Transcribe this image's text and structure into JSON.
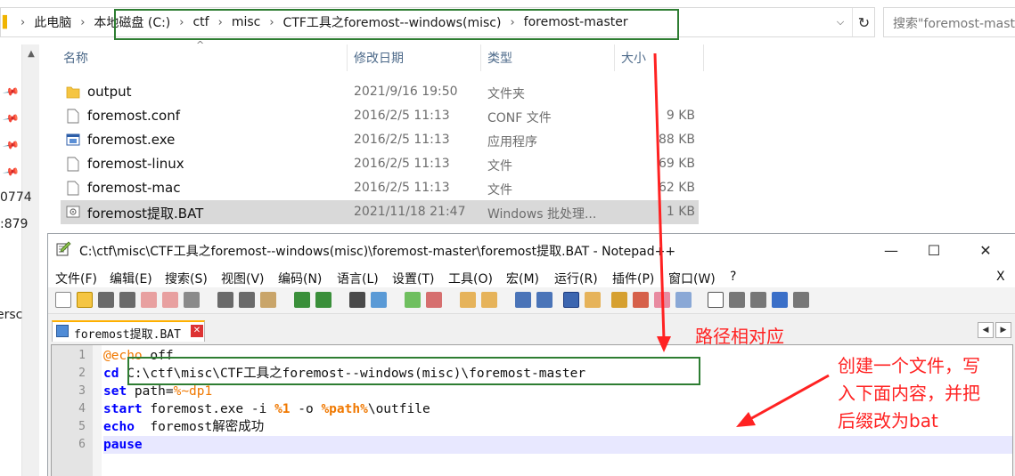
{
  "explorer": {
    "breadcrumbs": [
      "此电脑",
      "本地磁盘 (C:)",
      "ctf",
      "misc",
      "CTF工具之foremost--windows(misc)",
      "foremost-master"
    ],
    "breadcrumb_sep": "›",
    "dropdown_glyph": "⌵",
    "refresh_glyph": "↻",
    "search_placeholder": "搜索\"foremost-master\"",
    "scroll_up_glyph": "▲",
    "sort_glyph": "^",
    "pin_glyph": "📌",
    "left_cut_text": [
      "0774",
      ":879",
      "ersc"
    ],
    "columns": {
      "name": "名称",
      "date": "修改日期",
      "type": "类型",
      "size": "大小"
    },
    "files": [
      {
        "name": "output",
        "date": "2021/9/16 19:50",
        "type": "文件夹",
        "size": "",
        "icon": "folder-icon"
      },
      {
        "name": "foremost.conf",
        "date": "2016/2/5 11:13",
        "type": "CONF 文件",
        "size": "9 KB",
        "icon": "file-icon"
      },
      {
        "name": "foremost.exe",
        "date": "2016/2/5 11:13",
        "type": "应用程序",
        "size": "88 KB",
        "icon": "exe-icon"
      },
      {
        "name": "foremost-linux",
        "date": "2016/2/5 11:13",
        "type": "文件",
        "size": "69 KB",
        "icon": "file-icon"
      },
      {
        "name": "foremost-mac",
        "date": "2016/2/5 11:13",
        "type": "文件",
        "size": "62 KB",
        "icon": "file-icon"
      },
      {
        "name": "foremost提取.BAT",
        "date": "2021/11/18 21:47",
        "type": "Windows 批处理...",
        "size": "1 KB",
        "icon": "bat-icon",
        "selected": true
      }
    ]
  },
  "notepad": {
    "title": "C:\\ctf\\misc\\CTF工具之foremost--windows(misc)\\foremost-master\\foremost提取.BAT - Notepad++",
    "window_buttons": {
      "minimize": "—",
      "maximize": "☐",
      "close": "✕"
    },
    "menu": [
      "文件(F)",
      "编辑(E)",
      "搜索(S)",
      "视图(V)",
      "编码(N)",
      "语言(L)",
      "设置(T)",
      "工具(O)",
      "宏(M)",
      "运行(R)",
      "插件(P)",
      "窗口(W)",
      "?"
    ],
    "menu_close": "X",
    "tab": {
      "label": "foremost提取.BAT",
      "close": "✕"
    },
    "tab_arrows": [
      "◀",
      "▶"
    ],
    "line_numbers": [
      "1",
      "2",
      "3",
      "4",
      "5",
      "6"
    ],
    "code": {
      "l1_kw": "@echo",
      "l1_rest": " off",
      "l2_kw": "cd",
      "l2_rest": " C:\\ctf\\misc\\CTF工具之foremost--windows(misc)\\foremost-master",
      "l3_kw": "set",
      "l3_a": " path=",
      "l3_var": "%~dp1",
      "l4_kw": "start",
      "l4_a": " foremost.exe -i ",
      "l4_v1": "%1",
      "l4_b": " -o ",
      "l4_v2": "%path%",
      "l4_c": "\\outfile",
      "l5_kw": "echo",
      "l5_rest": "  foremost解密成功",
      "l6_kw": "pause"
    }
  },
  "annotations": {
    "path_note": "路径相对应",
    "create_note": [
      "创建一个文件，写",
      "入下面内容，并把",
      "后缀改为bat"
    ]
  },
  "colors": {
    "annotation_red": "#ff2222",
    "highlight_green": "#2e7d32",
    "keyword_blue": "#0000ff",
    "variable_orange": "#f07800"
  }
}
